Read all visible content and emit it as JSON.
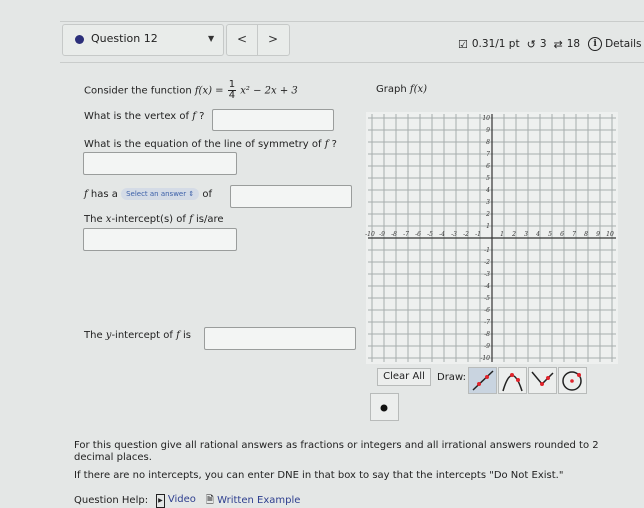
{
  "header": {
    "question_label": "Question 12",
    "prev_label": "<",
    "next_label": ">",
    "score": "0.31/1 pt",
    "retries_icon": "undo-icon",
    "retries": "3",
    "attempts_icon": "repeat-icon",
    "attempts": "18",
    "details_label": "Details",
    "status_color": "#2c2f7a"
  },
  "question": {
    "intro": "Consider the function",
    "function_lhs": "f(x) =",
    "frac_num": "1",
    "frac_den": "4",
    "function_rest": "x² − 2x + 3",
    "vertex_prompt": "What is the vertex of",
    "f": "f",
    "q_mark": "?",
    "symmetry_prompt": "What is the equation of the line of symmetry of",
    "has_a": "has a",
    "select_placeholder": "Select an answer",
    "of": "of",
    "xint_prefix": "The",
    "x_var": "x",
    "xint_suffix": "-intercept(s) of",
    "is_are": "is/are",
    "yint_prefix": "The",
    "y_var": "y",
    "yint_suffix": "-intercept of",
    "is": "is",
    "answers": {
      "vertex": "",
      "symmetry": "",
      "extremum_value": "",
      "x_intercepts": "",
      "y_intercept": ""
    }
  },
  "graph": {
    "title_prefix": "Graph",
    "title_func": "f(x)",
    "x_ticks": [
      -10,
      -9,
      -8,
      -7,
      -6,
      -5,
      -4,
      -3,
      -2,
      -1,
      1,
      2,
      3,
      4,
      5,
      6,
      7,
      8,
      9,
      10
    ],
    "y_ticks": [
      -10,
      -9,
      -8,
      -7,
      -6,
      -5,
      -4,
      -3,
      -2,
      -1,
      1,
      2,
      3,
      4,
      5,
      6,
      7,
      8,
      9,
      10
    ],
    "clear_label": "Clear All",
    "draw_label": "Draw:",
    "tools": [
      "line-tool",
      "parabola-tool",
      "absolute-value-tool",
      "circle-tool"
    ],
    "point_tool": "point-tool",
    "accent": "#e0242c"
  },
  "footer": {
    "note1": "For this question give all rational answers as fractions or integers and all irrational answers rounded to 2 decimal places.",
    "note2": "If there are no intercepts, you can enter DNE in that box to say that the intercepts \"Do Not Exist.\"",
    "help_label": "Question Help:",
    "video_label": "Video",
    "example_label": "Written Example"
  }
}
